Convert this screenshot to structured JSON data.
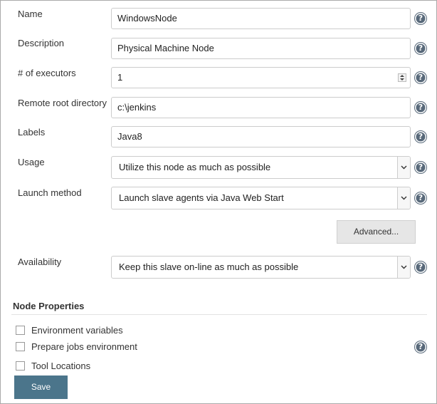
{
  "form": {
    "name": {
      "label": "Name",
      "value": "WindowsNode"
    },
    "description": {
      "label": "Description",
      "value": "Physical Machine Node"
    },
    "executors": {
      "label": "# of executors",
      "value": "1"
    },
    "remote_root": {
      "label": "Remote root directory",
      "value": "c:\\jenkins"
    },
    "labels": {
      "label": "Labels",
      "value": "Java8"
    },
    "usage": {
      "label": "Usage",
      "value": "Utilize this node as much as possible"
    },
    "launch_method": {
      "label": "Launch method",
      "value": "Launch slave agents via Java Web Start"
    },
    "advanced_label": "Advanced...",
    "availability": {
      "label": "Availability",
      "value": "Keep this slave on-line as much as possible"
    }
  },
  "node_properties": {
    "title": "Node Properties",
    "items": [
      {
        "label": "Environment variables",
        "checked": false
      },
      {
        "label": "Prepare jobs environment",
        "checked": false
      },
      {
        "label": "Tool Locations",
        "checked": false
      }
    ]
  },
  "help_glyph": "?",
  "save_label": "Save",
  "colors": {
    "help_icon": "#58697a",
    "save_button": "#4b758b",
    "advanced_button": "#e6e6e6",
    "field_border": "#cccccc"
  },
  "icons": {
    "help": "help-icon",
    "dropdown": "chevron-down-icon",
    "spinner": "stepper-icon"
  }
}
